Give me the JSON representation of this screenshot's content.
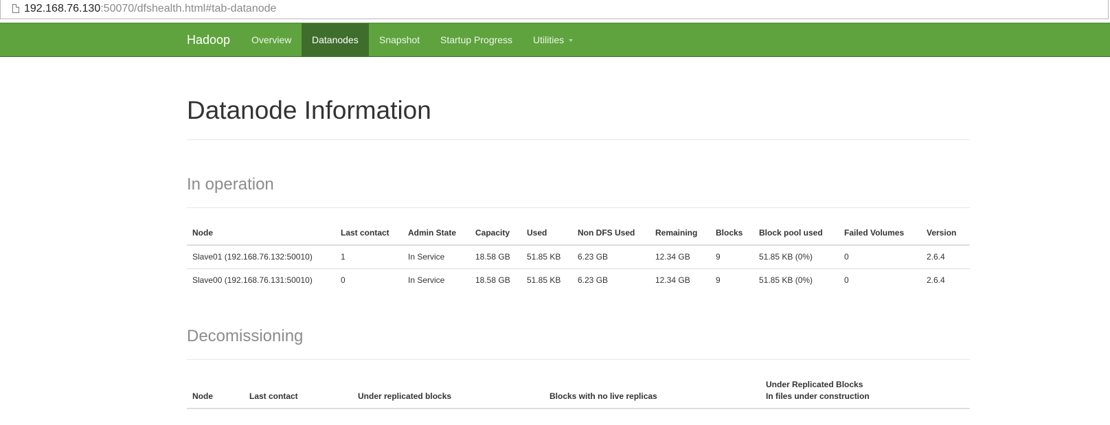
{
  "browser": {
    "url_host": "192.168.76.130",
    "url_rest": ":50070/dfshealth.html#tab-datanode"
  },
  "navbar": {
    "brand": "Hadoop",
    "items": [
      {
        "label": "Overview"
      },
      {
        "label": "Datanodes"
      },
      {
        "label": "Snapshot"
      },
      {
        "label": "Startup Progress"
      },
      {
        "label": "Utilities"
      }
    ],
    "active": "Datanodes",
    "color": "#5fa33e",
    "active_color": "#3f6e2c"
  },
  "page": {
    "title": "Datanode Information"
  },
  "in_operation": {
    "heading": "In operation",
    "columns": [
      "Node",
      "Last contact",
      "Admin State",
      "Capacity",
      "Used",
      "Non DFS Used",
      "Remaining",
      "Blocks",
      "Block pool used",
      "Failed Volumes",
      "Version"
    ],
    "rows": [
      [
        "Slave01 (192.168.76.132:50010)",
        "1",
        "In Service",
        "18.58 GB",
        "51.85 KB",
        "6.23 GB",
        "12.34 GB",
        "9",
        "51.85 KB (0%)",
        "0",
        "2.6.4"
      ],
      [
        "Slave00 (192.168.76.131:50010)",
        "0",
        "In Service",
        "18.58 GB",
        "51.85 KB",
        "6.23 GB",
        "12.34 GB",
        "9",
        "51.85 KB (0%)",
        "0",
        "2.6.4"
      ]
    ]
  },
  "decommissioning": {
    "heading": "Decomissioning",
    "columns": [
      "Node",
      "Last contact",
      "Under replicated blocks",
      "Blocks with no live replicas",
      "Under Replicated Blocks",
      "In files under construction"
    ]
  }
}
